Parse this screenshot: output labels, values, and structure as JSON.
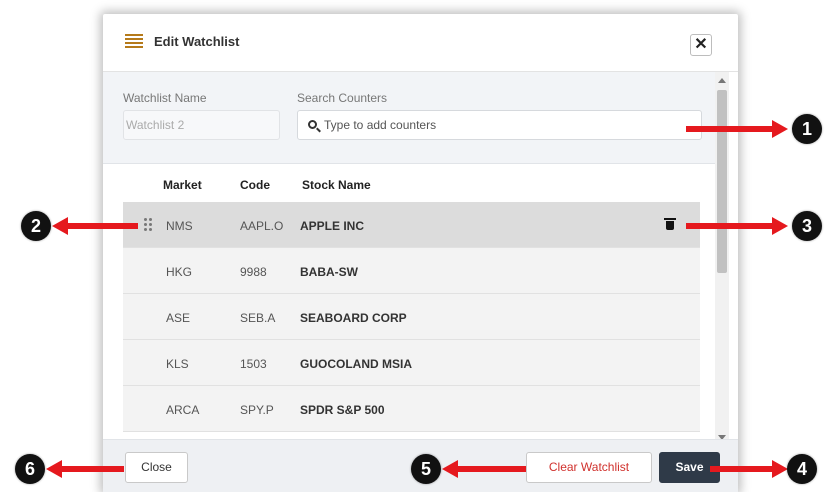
{
  "modal": {
    "title": "Edit Watchlist",
    "close_symbol": "✕",
    "header_icon": "menu-lines-icon"
  },
  "form": {
    "watchlist_name_label": "Watchlist Name",
    "watchlist_name_value": "Watchlist 2",
    "search_label": "Search Counters",
    "search_placeholder": "Type to add counters",
    "search_icon": "search-icon"
  },
  "table": {
    "columns": [
      "Market",
      "Code",
      "Stock Name"
    ],
    "rows": [
      {
        "market": "NMS",
        "code": "AAPL.O",
        "name": "APPLE INC",
        "selected": true
      },
      {
        "market": "HKG",
        "code": "9988",
        "name": "BABA-SW",
        "selected": false
      },
      {
        "market": "ASE",
        "code": "SEB.A",
        "name": "SEABOARD CORP",
        "selected": false
      },
      {
        "market": "KLS",
        "code": "1503",
        "name": "GUOCOLAND MSIA",
        "selected": false
      },
      {
        "market": "ARCA",
        "code": "SPY.P",
        "name": "SPDR S&P 500",
        "selected": false
      }
    ]
  },
  "footer": {
    "close_label": "Close",
    "clear_label": "Clear Watchlist",
    "save_label": "Save"
  },
  "callouts": [
    "1",
    "2",
    "3",
    "4",
    "5",
    "6"
  ],
  "colors": {
    "accent_icon": "#b57a1a",
    "arrow": "#e5191e",
    "clear_text": "#d0312d",
    "save_bg": "#2f3a48"
  }
}
